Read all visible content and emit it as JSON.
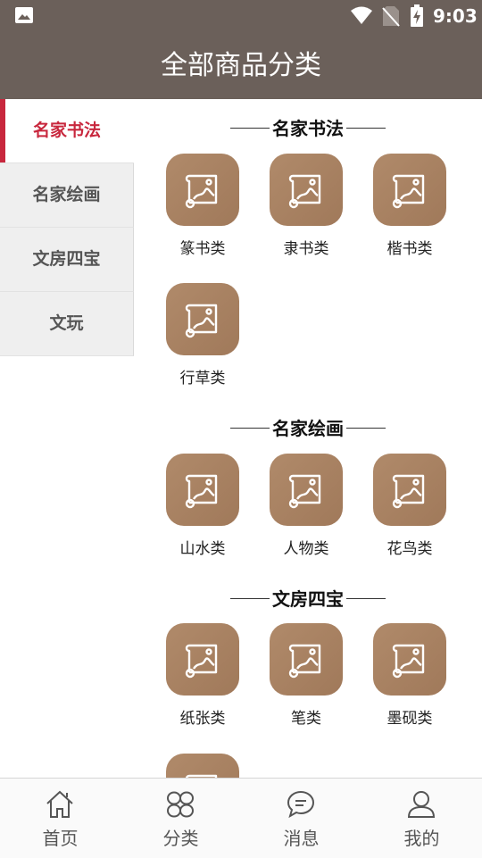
{
  "status_bar": {
    "time": "9:03"
  },
  "header": {
    "title": "全部商品分类"
  },
  "sidebar": {
    "items": [
      {
        "label": "名家书法",
        "active": true
      },
      {
        "label": "名家绘画",
        "active": false
      },
      {
        "label": "文房四宝",
        "active": false
      },
      {
        "label": "文玩",
        "active": false
      }
    ]
  },
  "sections": [
    {
      "title": "名家书法",
      "items": [
        "篆书类",
        "隶书类",
        "楷书类",
        "行草类"
      ]
    },
    {
      "title": "名家绘画",
      "items": [
        "山水类",
        "人物类",
        "花鸟类"
      ]
    },
    {
      "title": "文房四宝",
      "items": [
        "纸张类",
        "笔类",
        "墨砚类"
      ]
    }
  ],
  "tabbar": {
    "tabs": [
      {
        "label": "首页",
        "icon": "home-icon"
      },
      {
        "label": "分类",
        "icon": "category-icon"
      },
      {
        "label": "消息",
        "icon": "message-icon"
      },
      {
        "label": "我的",
        "icon": "user-icon"
      }
    ]
  },
  "colors": {
    "header_bg": "#6b605a",
    "accent": "#c8273d",
    "tile": "#a88263"
  }
}
